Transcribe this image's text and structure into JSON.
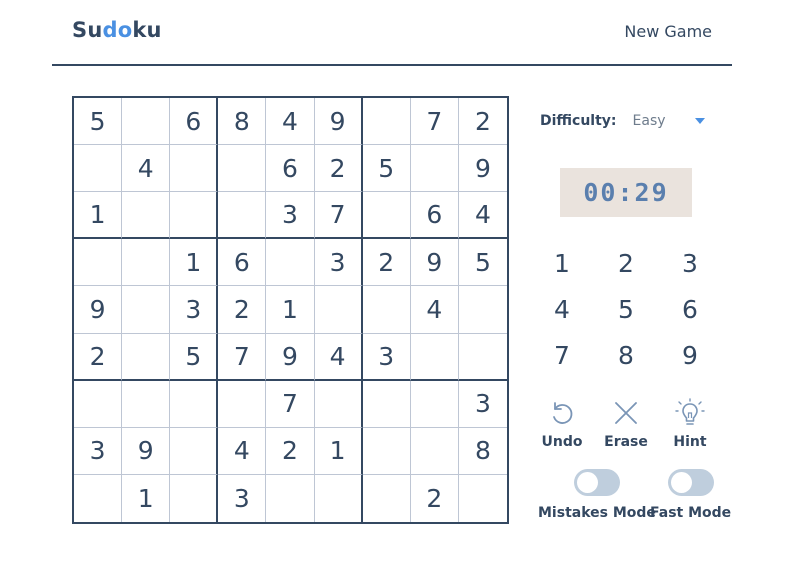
{
  "header": {
    "logo": {
      "part1": "Su",
      "part2": "do",
      "part3": "ku"
    },
    "new_game_label": "New Game"
  },
  "board": {
    "rows": [
      [
        "5",
        "",
        "6",
        "8",
        "4",
        "9",
        "",
        "7",
        "2"
      ],
      [
        "",
        "4",
        "",
        "",
        "6",
        "2",
        "5",
        "",
        "9"
      ],
      [
        "1",
        "",
        "",
        "",
        "3",
        "7",
        "",
        "6",
        "4"
      ],
      [
        "",
        "",
        "1",
        "6",
        "",
        "3",
        "2",
        "9",
        "5"
      ],
      [
        "9",
        "",
        "3",
        "2",
        "1",
        "",
        "",
        "4",
        ""
      ],
      [
        "2",
        "",
        "5",
        "7",
        "9",
        "4",
        "3",
        "",
        ""
      ],
      [
        "",
        "",
        "",
        "",
        "7",
        "",
        "",
        "",
        "3"
      ],
      [
        "3",
        "9",
        "",
        "4",
        "2",
        "1",
        "",
        "",
        "8"
      ],
      [
        "",
        "1",
        "",
        "3",
        "",
        "",
        "",
        "2",
        ""
      ]
    ]
  },
  "sidebar": {
    "difficulty_label": "Difficulty:",
    "difficulty_value": "Easy",
    "timer": "00:29",
    "numpad": [
      "1",
      "2",
      "3",
      "4",
      "5",
      "6",
      "7",
      "8",
      "9"
    ],
    "tools": {
      "undo": "Undo",
      "erase": "Erase",
      "hint": "Hint"
    },
    "toggles": {
      "mistakes_mode": {
        "label": "Mistakes Mode",
        "on": false
      },
      "fast_mode": {
        "label": "Fast Mode",
        "on": false
      }
    }
  },
  "colors": {
    "text": "#344861",
    "accent": "#4a90e2",
    "grid_line": "#bec6d4",
    "timer_bg": "#eae3dd",
    "timer_text": "#5a7fae",
    "toggle_off": "#bfcedd"
  },
  "icons": {
    "undo": "undo-icon",
    "erase": "close-icon",
    "hint": "lightbulb-icon",
    "difficulty": "caret-down-icon"
  }
}
